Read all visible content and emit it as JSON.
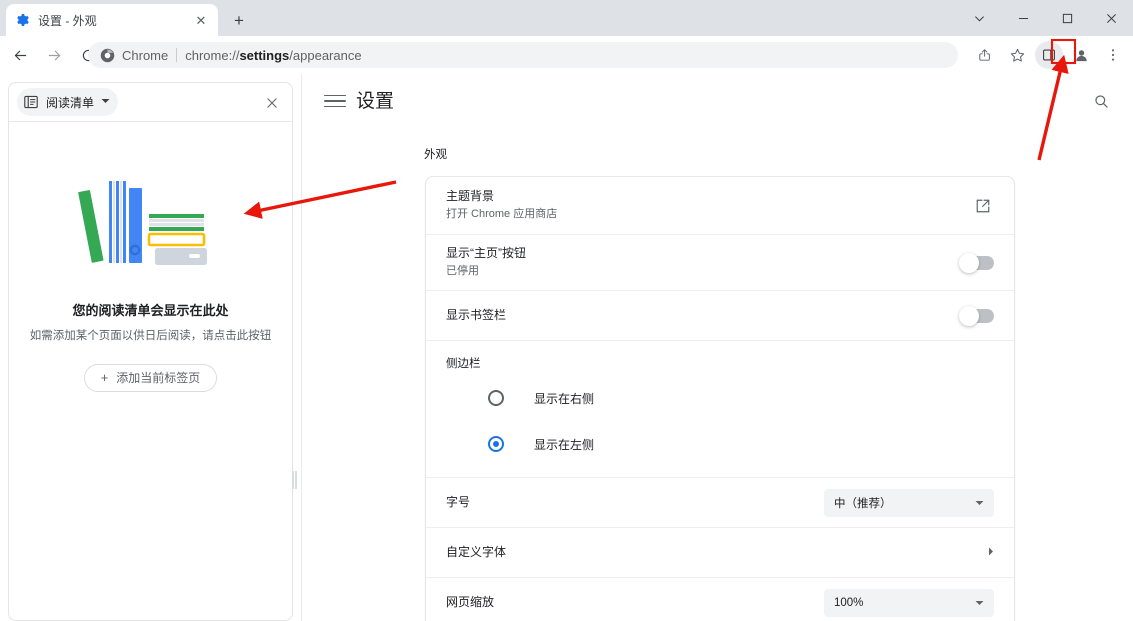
{
  "window": {
    "controls": [
      {
        "name": "tab-search-chevron",
        "glyph": "⌄"
      },
      {
        "name": "minimize",
        "glyph": "−"
      },
      {
        "name": "maximize",
        "glyph": "□"
      },
      {
        "name": "close",
        "glyph": "✕"
      }
    ]
  },
  "tabs": {
    "active": {
      "title": "设置 - 外观",
      "favicon": "settings-gear-icon",
      "close_glyph": "✕"
    },
    "new_tab_glyph": "+"
  },
  "toolbar": {
    "back_label": "←",
    "forward_label": "→",
    "reload_label": "⟳",
    "omnibox": {
      "brand": "Chrome",
      "url_prefix": "chrome://",
      "url_bold": "settings",
      "url_suffix": "/appearance"
    },
    "share_icon": "share-icon",
    "bookmark_icon": "star-icon",
    "side_panel_icon": "side-panel-icon",
    "profile_icon": "profile-avatar-icon",
    "menu_icon": "three-dot-menu-icon"
  },
  "side_panel": {
    "combo_label": "阅读清单",
    "combo_caret": "▾",
    "close_glyph": "✕",
    "empty_title": "您的阅读清单会显示在此处",
    "empty_subtitle": "如需添加某个页面以供日后阅读，请点击此按钮",
    "add_button_plus": "+",
    "add_button_label": "添加当前标签页"
  },
  "settings": {
    "title": "设置",
    "hamburger_icon": "hamburger-menu-icon",
    "search_icon": "search-icon",
    "section_label": "外观",
    "rows": {
      "theme": {
        "title": "主题背景",
        "subtitle": "打开 Chrome 应用商店",
        "icon": "external-link-icon"
      },
      "home_button": {
        "title": "显示“主页”按钮",
        "subtitle": "已停用",
        "toggle_on": false
      },
      "bookmarks_bar": {
        "title": "显示书签栏",
        "toggle_on": false
      },
      "sidebar": {
        "label": "侧边栏",
        "options": [
          {
            "label": "显示在右侧",
            "selected": false
          },
          {
            "label": "显示在左侧",
            "selected": true
          }
        ]
      },
      "font_size": {
        "title": "字号",
        "value": "中（推荐）",
        "caret": "▾"
      },
      "custom_fonts": {
        "title": "自定义字体",
        "caret": "▸"
      },
      "page_zoom": {
        "title": "网页缩放",
        "value": "100%",
        "caret": "▾"
      }
    }
  },
  "annotations": {
    "accent_color": "#e8170b",
    "highlight_box_target": "side-panel-icon",
    "arrow_to_panel_icon": "arrow-pointing-to-side-panel-button",
    "arrow_to_reading_list": "arrow-pointing-to-reading-list-panel"
  }
}
